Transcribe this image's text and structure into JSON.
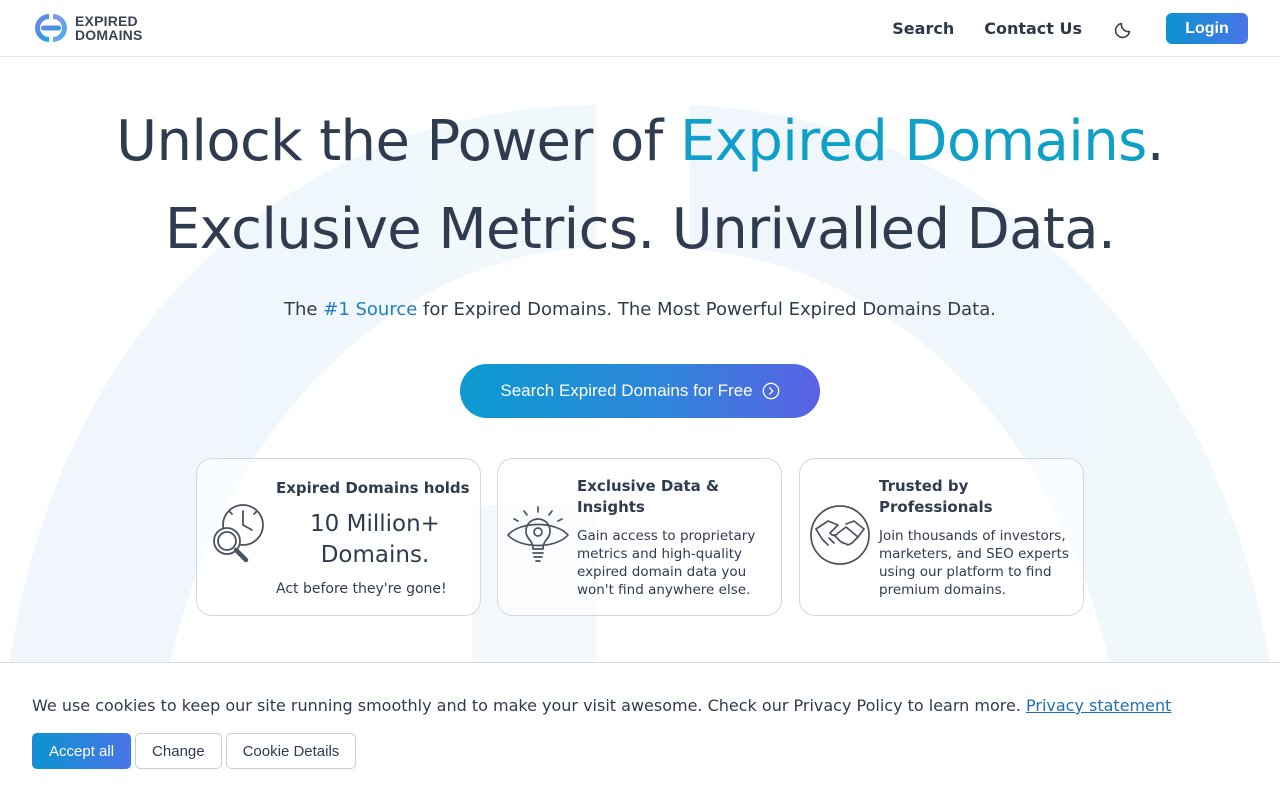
{
  "header": {
    "logo_line1": "EXPIRED",
    "logo_line2": "DOMAINS",
    "nav": [
      {
        "label": "Search"
      },
      {
        "label": "Contact Us"
      }
    ],
    "theme_icon": "moon-icon",
    "login_label": "Login"
  },
  "hero": {
    "line1_pre": "Unlock the Power of ",
    "line1_accent": "Expired Domains",
    "line1_post": ".",
    "line2": "Exclusive Metrics. Unrivalled Data.",
    "sub_pre": "The ",
    "sub_highlight": "#1 Source",
    "sub_post": " for Expired Domains. The Most Powerful Expired Domains Data.",
    "cta_label": "Search Expired Domains for Free",
    "cta_icon": "arrow-circle-right-icon"
  },
  "cards": [
    {
      "icon": "magnifier-clock-icon",
      "title": "Expired Domains holds",
      "big_line1": "10 Million+",
      "big_line2": "Domains.",
      "small": "Act before they're gone!"
    },
    {
      "icon": "lightbulb-eye-icon",
      "title": "Exclusive Data & Insights",
      "desc": "Gain access to proprietary metrics and high-quality expired domain data you won't find anywhere else."
    },
    {
      "icon": "handshake-icon",
      "title": "Trusted by Professionals",
      "desc": "Join thousands of investors, marketers, and SEO experts using our platform to find premium domains."
    }
  ],
  "cookie": {
    "text": "We use cookies to keep our site running smoothly and to make your visit awesome. Check our Privacy Policy to learn more. ",
    "link": "Privacy statement",
    "accept": "Accept all",
    "change": "Change",
    "details": "Cookie Details"
  },
  "colors": {
    "accent": "#0fa0c9",
    "brand_gradient_start": "#0b94d0",
    "brand_gradient_end": "#5a62e4",
    "text": "#2f3b4f"
  }
}
